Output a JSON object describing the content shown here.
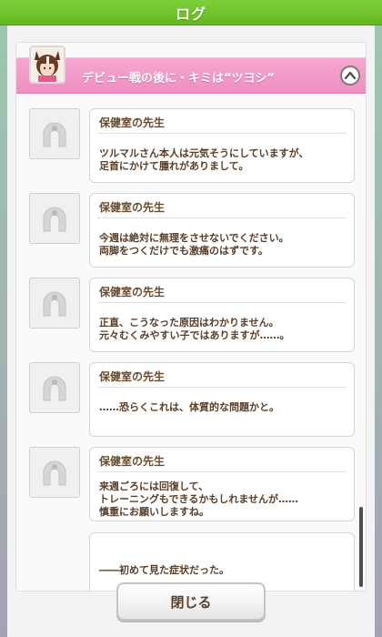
{
  "header": {
    "title": "ログ"
  },
  "chapter": {
    "title": "デビュー戦の後に・キミは“ツヨシ”"
  },
  "entries": [
    {
      "speaker": "保健室の先生",
      "text": "ツルマルさん本人は元気そうにしていますが、\n足首にかけて腫れがありまして。"
    },
    {
      "speaker": "保健室の先生",
      "text": "今週は絶対に無理をさせないでください。\n両脚をつくだけでも激痛のはずです。"
    },
    {
      "speaker": "保健室の先生",
      "text": "正直、こうなった原因はわかりません。\n元々むくみやすい子ではありますが……。"
    },
    {
      "speaker": "保健室の先生",
      "text": "……恐らくこれは、体質的な問題かと。"
    },
    {
      "speaker": "保健室の先生",
      "text": "来週ごろには回復して、\nトレーニングもできるかもしれませんが……\n慎重にお願いしますね。"
    },
    {
      "speaker": "",
      "text": "――初めて見た症状だった。"
    }
  ],
  "footer": {
    "close_label": "閉じる"
  },
  "colors": {
    "header_green": "#6cc12a",
    "chapter_pink": "#f29cc8",
    "text_brown": "#5a3e28"
  }
}
